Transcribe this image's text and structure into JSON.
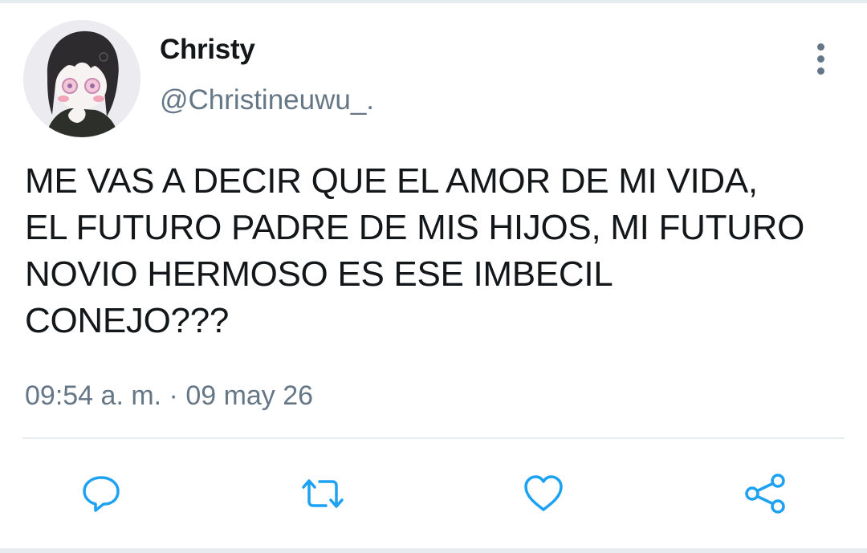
{
  "user": {
    "display_name": "Christy",
    "handle": "@Christineuwu_."
  },
  "tweet": {
    "text": "ME VAS A DECIR QUE EL AMOR DE MI VIDA,\nEL FUTURO PADRE DE MIS HIJOS, MI FUTURO\nNOVIO HERMOSO ES ESE IMBECIL\nCONEJO???",
    "timestamp": "09:54 a. m. · 09 may 26"
  },
  "icons": {
    "more": "more-vertical-icon",
    "reply": "reply-icon",
    "retweet": "retweet-icon",
    "like": "heart-icon",
    "share": "share-icon"
  },
  "colors": {
    "text_primary": "#14171a",
    "text_secondary": "#657786",
    "action_icon": "#1da1f2",
    "divider": "#e6ecf0"
  }
}
